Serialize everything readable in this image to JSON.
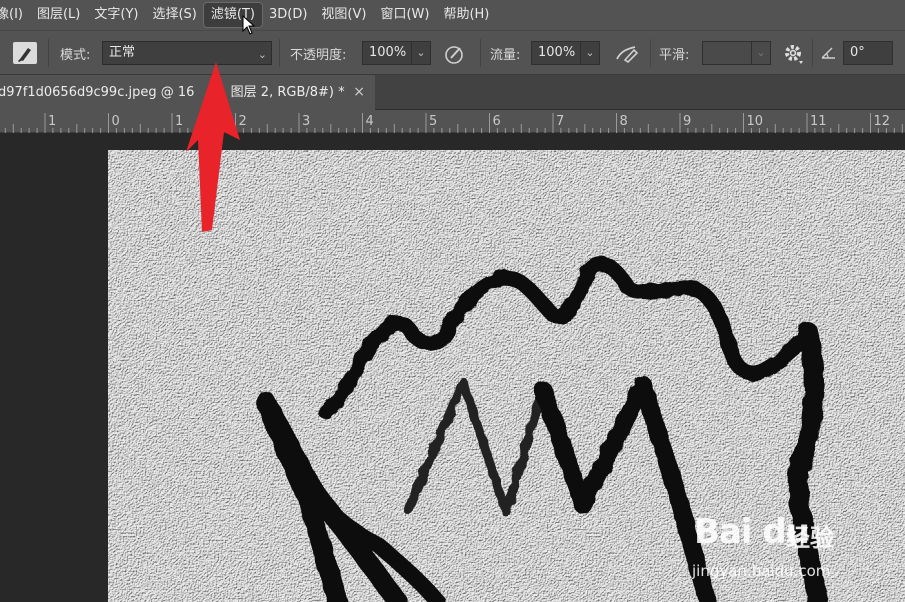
{
  "menubar": {
    "items": [
      {
        "label": "像(I)"
      },
      {
        "label": "图层(L)"
      },
      {
        "label": "文字(Y)"
      },
      {
        "label": "选择(S)"
      },
      {
        "label": "滤镜(T)"
      },
      {
        "label": "3D(D)"
      },
      {
        "label": "视图(V)"
      },
      {
        "label": "窗口(W)"
      },
      {
        "label": "帮助(H)"
      }
    ]
  },
  "options_bar": {
    "mode_label": "模式:",
    "mode_value": "正常",
    "opacity_label": "不透明度:",
    "opacity_value": "100%",
    "flow_label": "流量:",
    "flow_value": "100%",
    "smoothing_label": "平滑:",
    "smoothing_value": "",
    "angle_value": "0°"
  },
  "document_tab": {
    "title": "d97f1d0656d9c99c.jpeg @ 16",
    "title_rest": "图层 2, RGB/8#) *",
    "close": "×"
  },
  "ruler": {
    "labels": [
      "1",
      "0",
      "1",
      "2",
      "3",
      "4",
      "5",
      "6",
      "7",
      "8",
      "9",
      "10",
      "11",
      "12"
    ]
  },
  "watermark": {
    "logo": "Bai du",
    "brand": "经验",
    "url": "jingyan.baidu.com"
  },
  "colors": {
    "panel": "#535353",
    "background": "#282828",
    "arrow": "#e8232a"
  }
}
